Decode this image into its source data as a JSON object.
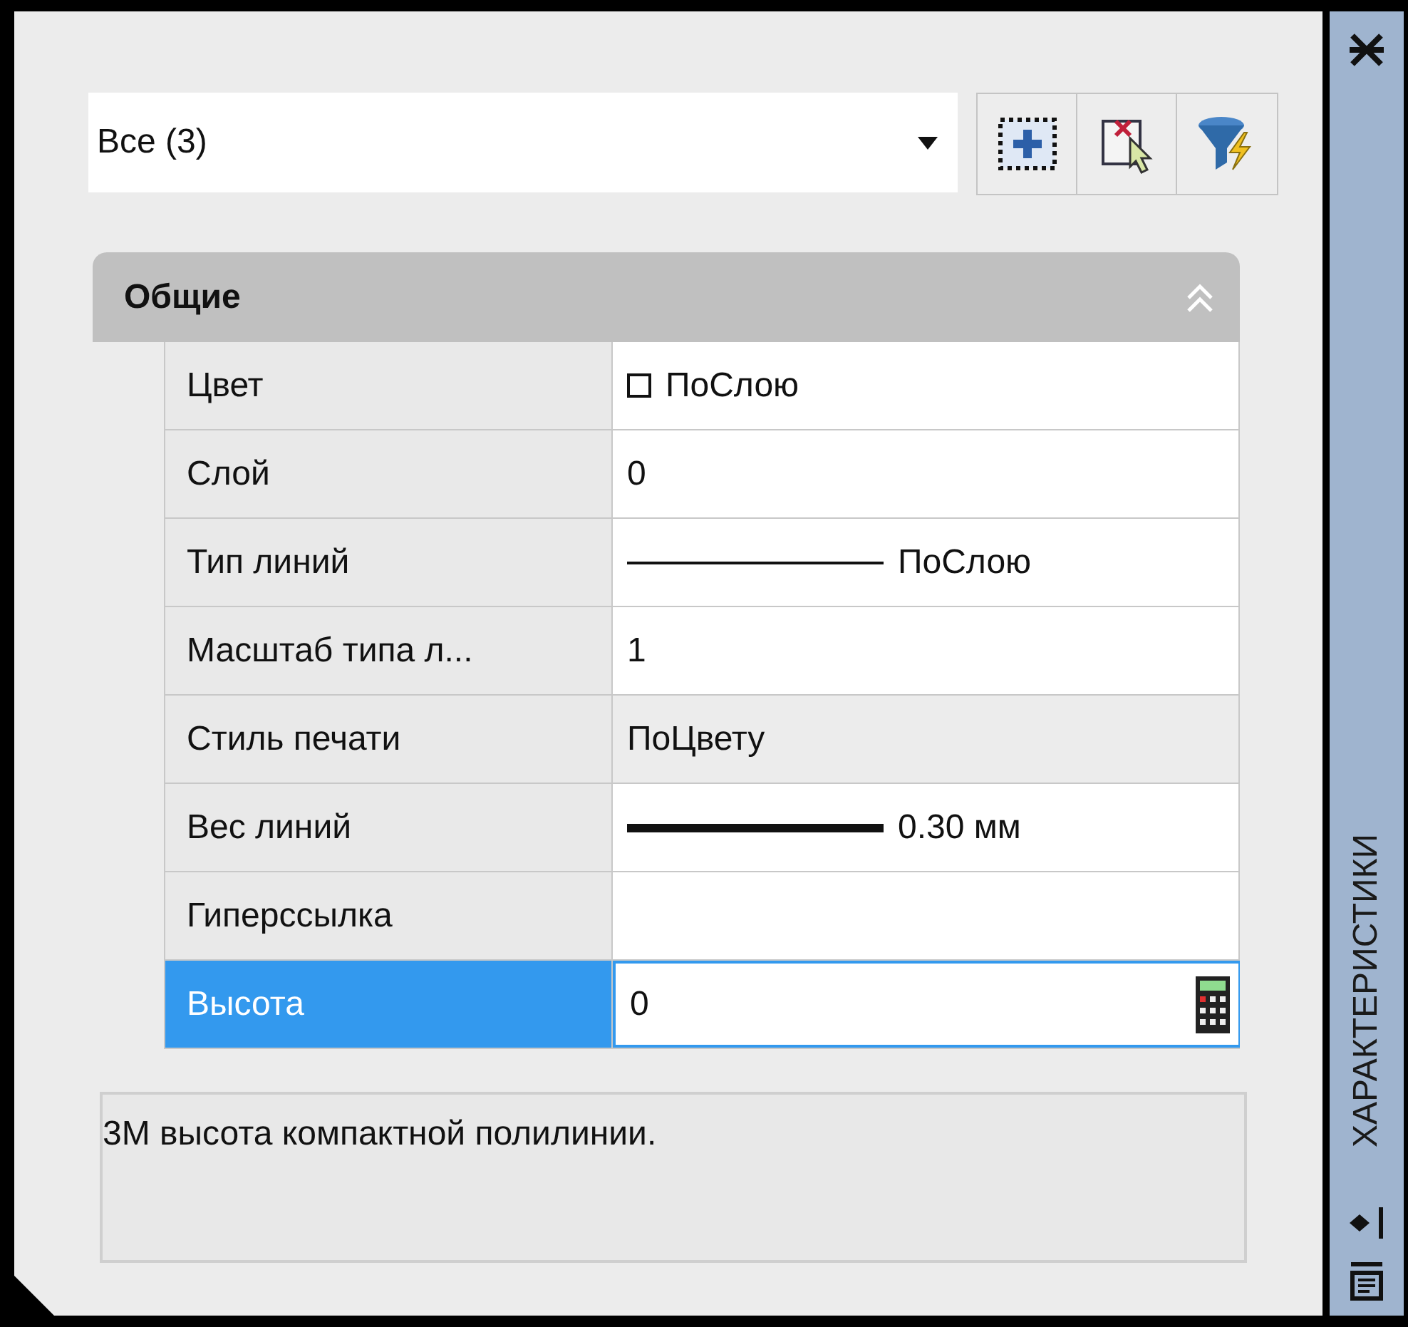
{
  "filter": {
    "value": "Все (3)"
  },
  "section": {
    "title": "Общие",
    "expanded": true
  },
  "properties": [
    {
      "label": "Цвет",
      "value": "ПоСлою",
      "kind": "color",
      "readonly": false,
      "selected": false
    },
    {
      "label": "Слой",
      "value": "0",
      "kind": "text",
      "readonly": false,
      "selected": false
    },
    {
      "label": "Тип линий",
      "value": "ПоСлою",
      "kind": "linetype",
      "readonly": false,
      "selected": false
    },
    {
      "label": "Масштаб типа л...",
      "value": "1",
      "kind": "text",
      "readonly": false,
      "selected": false
    },
    {
      "label": "Стиль печати",
      "value": "ПоЦвету",
      "kind": "text",
      "readonly": true,
      "selected": false
    },
    {
      "label": "Вес линий",
      "value": "0.30 мм",
      "kind": "lineweight",
      "readonly": false,
      "selected": false
    },
    {
      "label": "Гиперссылка",
      "kind": "text",
      "readonly": false,
      "selected": false
    },
    {
      "label": "Высота",
      "value": "0",
      "kind": "text",
      "readonly": false,
      "selected": true
    }
  ],
  "description": "3М высота компактной полилинии.",
  "side_title": "ХАРАКТЕРИСТИКИ"
}
